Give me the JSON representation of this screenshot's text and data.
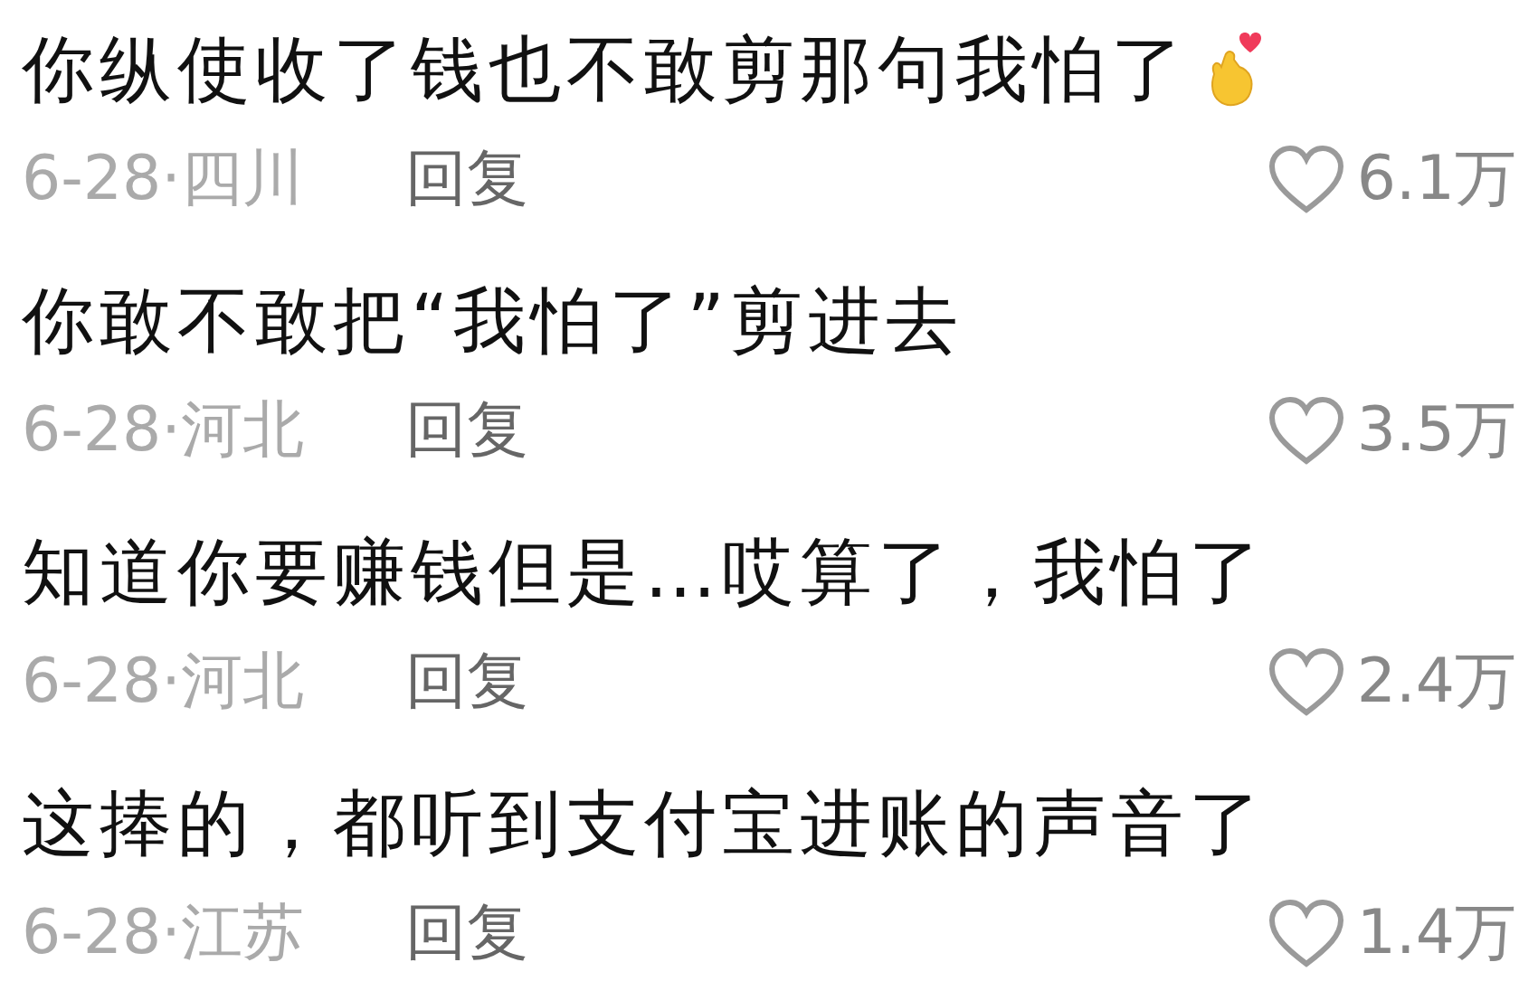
{
  "comments": [
    {
      "text": "你纵使收了钱也不敢剪那句我怕了",
      "sticker": true,
      "date": "6-28·四川",
      "reply": "回复",
      "likes": "6.1万"
    },
    {
      "text": "你敢不敢把“我怕了”剪进去",
      "sticker": false,
      "date": "6-28·河北",
      "reply": "回复",
      "likes": "3.5万"
    },
    {
      "text": "知道你要赚钱但是…哎算了，我怕了",
      "sticker": false,
      "date": "6-28·河北",
      "reply": "回复",
      "likes": "2.4万"
    },
    {
      "text": "这捧的，都听到支付宝进账的声音了",
      "sticker": false,
      "date": "6-28·江苏",
      "reply": "回复",
      "likes": "1.4万"
    }
  ]
}
